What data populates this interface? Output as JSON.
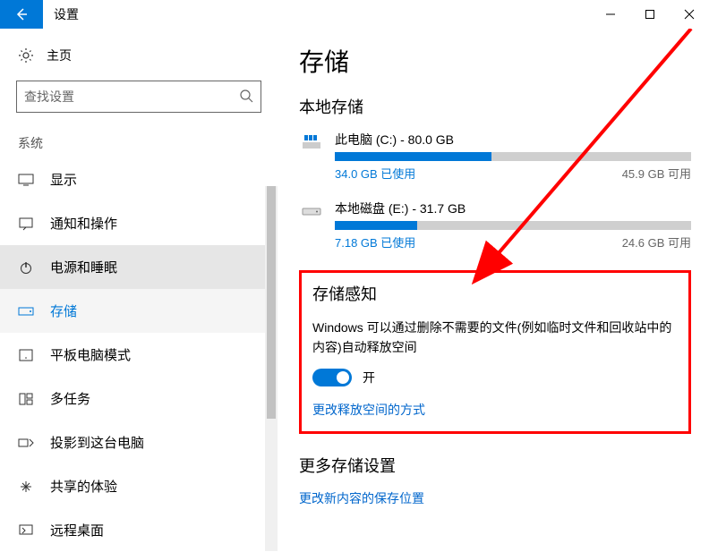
{
  "window": {
    "title": "设置"
  },
  "sidebar": {
    "home": "主页",
    "search_placeholder": "查找设置",
    "section": "系统",
    "items": [
      {
        "label": "显示"
      },
      {
        "label": "通知和操作"
      },
      {
        "label": "电源和睡眠"
      },
      {
        "label": "存储"
      },
      {
        "label": "平板电脑模式"
      },
      {
        "label": "多任务"
      },
      {
        "label": "投影到这台电脑"
      },
      {
        "label": "共享的体验"
      },
      {
        "label": "远程桌面"
      }
    ]
  },
  "content": {
    "title": "存储",
    "local_storage": "本地存储",
    "drives": [
      {
        "name": "此电脑 (C:) - 80.0 GB",
        "used": "34.0 GB 已使用",
        "free": "45.9 GB 可用",
        "percent": 44
      },
      {
        "name": "本地磁盘 (E:) - 31.7 GB",
        "used": "7.18 GB 已使用",
        "free": "24.6 GB 可用",
        "percent": 23
      }
    ],
    "sense": {
      "heading": "存储感知",
      "desc": "Windows 可以通过删除不需要的文件(例如临时文件和回收站中的内容)自动释放空间",
      "toggle_label": "开",
      "link": "更改释放空间的方式"
    },
    "more": {
      "heading": "更多存储设置",
      "link": "更改新内容的保存位置"
    }
  }
}
